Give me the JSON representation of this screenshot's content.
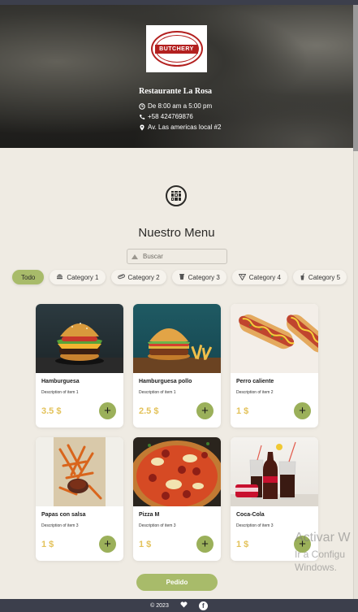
{
  "restaurant": {
    "logo_text": "BUTCHERY",
    "name": "Restaurante La Rosa",
    "hours": "De 8:00 am a 5:00 pm",
    "phone": "+58 424769876",
    "address": "Av. Las americas local #2"
  },
  "menu": {
    "title": "Nuestro Menu",
    "search_placeholder": "Buscar"
  },
  "categories": [
    {
      "label": "Todo",
      "icon": "none",
      "active": true
    },
    {
      "label": "Category 1",
      "icon": "burger-icon",
      "active": false
    },
    {
      "label": "Category 2",
      "icon": "hotdog-icon",
      "active": false
    },
    {
      "label": "Category 3",
      "icon": "cup-icon",
      "active": false
    },
    {
      "label": "Category 4",
      "icon": "pizza-icon",
      "active": false
    },
    {
      "label": "Category 5",
      "icon": "drink-icon",
      "active": false
    }
  ],
  "products": [
    {
      "name": "Hamburguesa",
      "description": "Description of item 1",
      "price": "3.5 $",
      "image": "burger-photo"
    },
    {
      "name": "Hamburguesa pollo",
      "description": "Description of item 1",
      "price": "2.5 $",
      "image": "chicken-burger-photo"
    },
    {
      "name": "Perro caliente",
      "description": "Description of item 2",
      "price": "1 $",
      "image": "hotdog-photo"
    },
    {
      "name": "Papas con salsa",
      "description": "Description of item 3",
      "price": "1 $",
      "image": "fries-photo"
    },
    {
      "name": "Pizza M",
      "description": "Description of item 3",
      "price": "1 $",
      "image": "pizza-photo"
    },
    {
      "name": "Coca-Cola",
      "description": "Description of item 3",
      "price": "1 $",
      "image": "cola-photo"
    }
  ],
  "add_label": "+",
  "order_button": "Pedido",
  "footer": {
    "copyright": "© 2023"
  },
  "watermark": {
    "line1": "Activar W",
    "line2": "Ir a Configu",
    "line3": "Windows."
  },
  "colors": {
    "accent": "#a8bb6a",
    "add_button": "#9bb05a",
    "price": "#e3c25a",
    "footer": "#3c3f4c"
  }
}
